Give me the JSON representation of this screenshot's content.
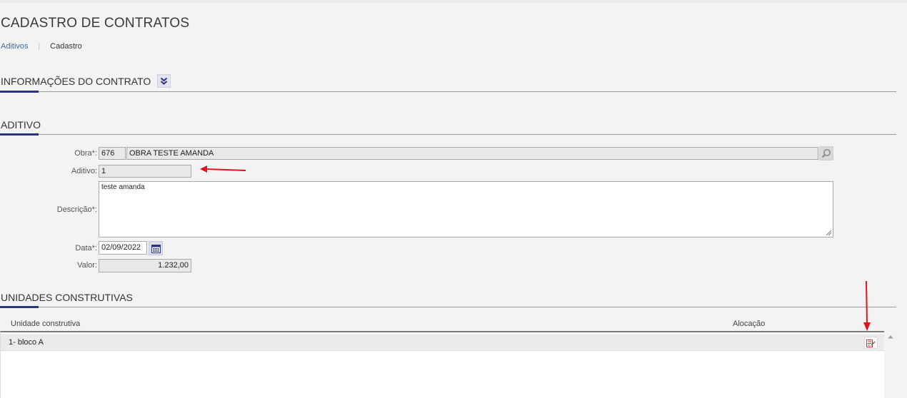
{
  "page": {
    "title": "CADASTRO DE CONTRATOS",
    "breadcrumb": {
      "link": "Aditivos",
      "current": "Cadastro"
    }
  },
  "sections": {
    "contract_info": "INFORMAÇÕES DO CONTRATO",
    "aditivo": "ADITIVO",
    "units": "UNIDADES CONSTRUTIVAS"
  },
  "form": {
    "obra": {
      "label": "Obra*:",
      "code": "676",
      "name": "OBRA TESTE AMANDA"
    },
    "aditivo": {
      "label": "Aditivo:",
      "value": "1"
    },
    "descricao": {
      "label": "Descrição*:",
      "value": "teste amanda"
    },
    "data": {
      "label": "Data*:",
      "value": "02/09/2022"
    },
    "valor": {
      "label": "Valor:",
      "value": "1.232,00"
    }
  },
  "grid": {
    "columns": [
      "Unidade construtiva",
      "Alocação"
    ],
    "rows": [
      {
        "unidade": "1- bloco A",
        "alocacao": ""
      }
    ]
  },
  "icons": {
    "collapse": "chevron-double-down-icon",
    "search": "search-icon",
    "calendar": "calendar-icon",
    "edit": "edit-icon",
    "scroll_up": "triangle-up-icon"
  },
  "colors": {
    "accent": "#2b3481",
    "annotation": "#e0141c",
    "edit_icon": "#d9322f"
  }
}
